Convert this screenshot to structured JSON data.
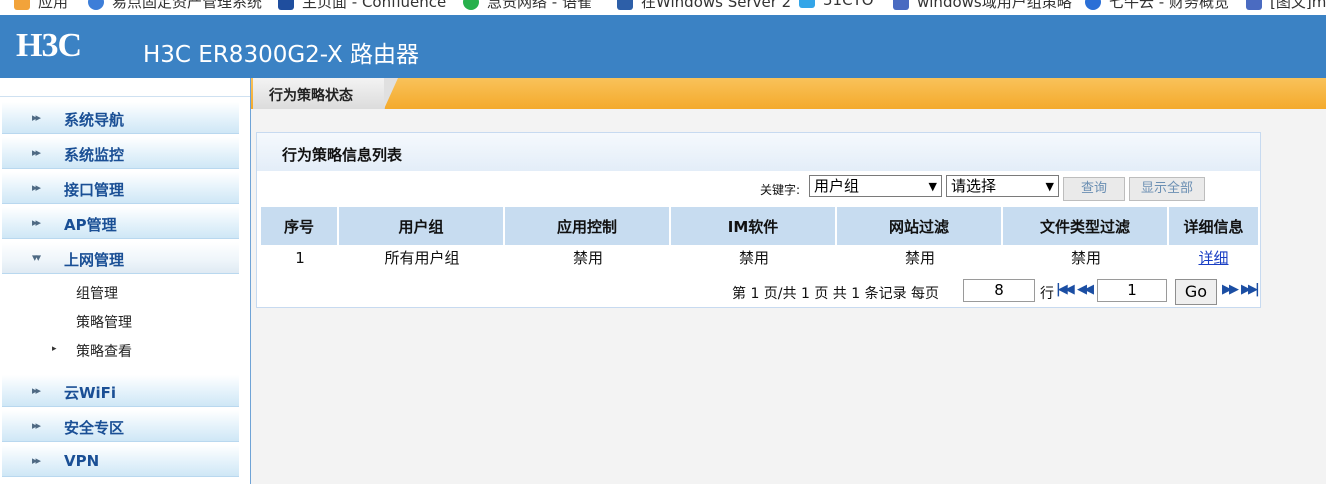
{
  "bookmarks": [
    {
      "label": "应用",
      "icon": "apps-icon",
      "color": "#f2a33a"
    },
    {
      "label": "易点固定资产管理系统",
      "icon": "bird-icon",
      "color": "#3d7ed8"
    },
    {
      "label": "主页面 - Confluence",
      "icon": "confluence-icon",
      "color": "#1f4e9e"
    },
    {
      "label": "急责网络 - 语雀",
      "icon": "yuque-icon",
      "color": "#27b04c"
    },
    {
      "label": "在Windows Server 2",
      "icon": "page-icon",
      "color": "#2d5fa8"
    },
    {
      "label": "51CTO",
      "icon": "51cto-icon",
      "color": "#33a5e8"
    },
    {
      "label": "windows域用户组策略",
      "icon": "site-icon",
      "color": "#4a6bc1"
    },
    {
      "label": "七牛云 - 财务概览",
      "icon": "qiniu-icon",
      "color": "#2b6fd6"
    },
    {
      "label": "[图文]m",
      "icon": "site-icon",
      "color": "#4a6bc1"
    }
  ],
  "header": {
    "logo": "H3C",
    "product": "H3C ER8300G2-X 路由器"
  },
  "sidebar": {
    "items": [
      {
        "label": "系统导航"
      },
      {
        "label": "系统监控"
      },
      {
        "label": "接口管理"
      },
      {
        "label": "AP管理"
      },
      {
        "label": "上网管理"
      },
      {
        "label": "云WiFi"
      },
      {
        "label": "安全专区"
      },
      {
        "label": "VPN"
      }
    ],
    "subitems": [
      {
        "label": "组管理"
      },
      {
        "label": "策略管理"
      },
      {
        "label": "策略查看"
      }
    ]
  },
  "tab": {
    "label": "行为策略状态"
  },
  "panel": {
    "title": "行为策略信息列表",
    "search": {
      "keyword_label": "关键字:",
      "field_select": "用户组",
      "value_select": "请选择",
      "query_button": "查询",
      "show_all_button": "显示全部"
    },
    "table": {
      "headers": [
        "序号",
        "用户组",
        "应用控制",
        "IM软件",
        "网站过滤",
        "文件类型过滤",
        "详细信息"
      ],
      "rows": [
        [
          "1",
          "所有用户组",
          "禁用",
          "禁用",
          "禁用",
          "禁用",
          "详细"
        ]
      ]
    },
    "pager": {
      "summary": "第 1 页/共 1 页 共 1 条记录 每页",
      "per_page": "8",
      "rows_unit": "行",
      "page_input": "1",
      "go_button": "Go"
    }
  },
  "colors": {
    "header_blue": "#3b82c4",
    "tab_orange": "#f4aa2c",
    "table_head": "#c7dcf0",
    "menu_text": "#1a4f95"
  }
}
